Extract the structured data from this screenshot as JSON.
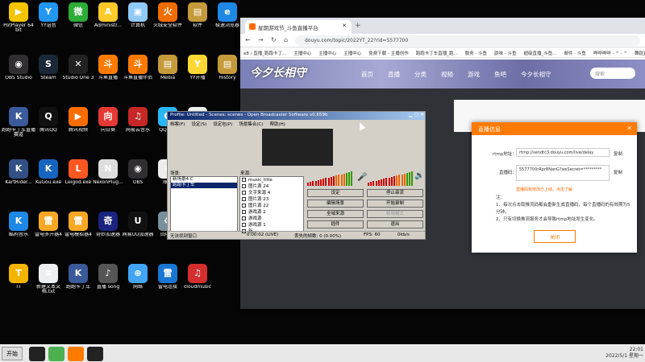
{
  "desktop_icons": [
    {
      "label": "PotPlayer 64 bit",
      "color": "#f5c400",
      "glyph": "▶"
    },
    {
      "label": "OBS Studio",
      "color": "#302e31",
      "glyph": "◉"
    },
    {
      "label": "跑跑卡丁车直播 赛道",
      "color": "#3a5a9a",
      "glyph": "K"
    },
    {
      "label": "KartRider...",
      "color": "#324f86",
      "glyph": "K"
    },
    {
      "label": "酷狗音乐",
      "color": "#1e88e5",
      "glyph": "K"
    },
    {
      "label": "TT",
      "color": "#f4b400",
      "glyph": "T"
    },
    {
      "label": "YY语音",
      "color": "#2196f3",
      "glyph": "Y"
    },
    {
      "label": "Steam",
      "color": "#1b2838",
      "glyph": "S"
    },
    {
      "label": "腾讯QQ",
      "color": "#111",
      "glyph": "Q"
    },
    {
      "label": "KuGou.exe",
      "color": "#1565c0",
      "glyph": "K"
    },
    {
      "label": "雷电多开器4",
      "color": "#f9a825",
      "glyph": "雷"
    },
    {
      "label": "新建文本文档.txt",
      "color": "#eceff1",
      "glyph": "≡"
    },
    {
      "label": "微信",
      "color": "#2bad37",
      "glyph": "微"
    },
    {
      "label": "Studio One 3",
      "color": "#222",
      "glyph": "✕"
    },
    {
      "label": "腾讯视频",
      "color": "#ff6d00",
      "glyph": "▶"
    },
    {
      "label": "Leigod.exe",
      "color": "#ff5722",
      "glyph": "L"
    },
    {
      "label": "雷电模拟器4",
      "color": "#f9a825",
      "glyph": "雷"
    },
    {
      "label": "跑跑卡丁车",
      "color": "#3a5a9a",
      "glyph": "K"
    },
    {
      "label": "Administr...",
      "color": "#ffca28",
      "glyph": "A"
    },
    {
      "label": "斗鱼直播",
      "color": "#ff7a00",
      "glyph": "斗"
    },
    {
      "label": "向日葵",
      "color": "#e53935",
      "glyph": "向"
    },
    {
      "label": "NexonPlug...",
      "color": "#ddd",
      "glyph": "N"
    },
    {
      "label": "奇妙加速器",
      "color": "#1a237e",
      "glyph": "奇"
    },
    {
      "label": "直播 song",
      "color": "#555",
      "glyph": "♪"
    },
    {
      "label": "计算机",
      "color": "#90caf9",
      "glyph": "▣"
    },
    {
      "label": "斗鱼直播伴侣",
      "color": "#ff7a00",
      "glyph": "斗"
    },
    {
      "label": "网易云音乐",
      "color": "#c62828",
      "glyph": "♫"
    },
    {
      "label": "OBS",
      "color": "#302e31",
      "glyph": "◉"
    },
    {
      "label": "网易UU加速器",
      "color": "#111",
      "glyph": "U"
    },
    {
      "label": "网络",
      "color": "#42a5f5",
      "glyph": "⊕"
    },
    {
      "label": "火绒安全软件",
      "color": "#ef6c00",
      "glyph": "火"
    },
    {
      "label": "Media",
      "color": "#c49a3a",
      "glyph": "▤"
    },
    {
      "label": "QQ游戏",
      "color": "#29b6f6",
      "glyph": "Q"
    },
    {
      "label": "账号",
      "color": "#eee",
      "glyph": "≡"
    },
    {
      "label": "回收站",
      "color": "#78909c",
      "glyph": "♻"
    },
    {
      "label": "雷电连接",
      "color": "#1976d2",
      "glyph": "雷"
    },
    {
      "label": "软件",
      "color": "#c49a3a",
      "glyph": "▤"
    },
    {
      "label": "YY开播",
      "color": "#fdd835",
      "glyph": "Y"
    },
    {
      "label": "直播效果 song",
      "color": "#eee",
      "glyph": "≡"
    },
    {
      "label": "Firefox",
      "color": "#ff7043",
      "glyph": "F"
    },
    {
      "label": "跑跑卡丁车",
      "color": "#3a5a9a",
      "glyph": "K"
    },
    {
      "label": "cloudmusic",
      "color": "#d32f2f",
      "glyph": "♫"
    },
    {
      "label": "极速浏览器",
      "color": "#1e88e5",
      "glyph": "e"
    },
    {
      "label": "History",
      "color": "#c49a3a",
      "glyph": "▤"
    }
  ],
  "taskbar": {
    "start_label": "开始",
    "time": "22:01",
    "date": "2022/5/1 星期一"
  },
  "browser": {
    "tab_title": "星期游戏节_斗鱼直播平台",
    "url": "douyu.com/topic/2022YT_22?rid=5577700",
    "bookmarks": [
      "e8 / 直播_跑跑卡丁...",
      "主播中心",
      "主播中心",
      "主播中心",
      "免费下载 - 主播创作",
      "跑跑卡丁车直播_跑...",
      "服务 · 斗鱼",
      "韵味 - 斗鱼",
      "超级直播_斗鱼...",
      "邮件 · 斗鱼",
      "哗哗哗哗 - ^ - ^",
      "舞蹈直播_斗鱼..."
    ],
    "site_logo": "今夕长相守",
    "site_nav": [
      "首页",
      "直播",
      "分类",
      "视频",
      "游戏",
      "鱼吧",
      "今夕长相守"
    ],
    "search_placeholder": "搜索"
  },
  "dialog": {
    "title": "直播信息",
    "close": "✕",
    "rtmp_label": "rtmp地址：",
    "rtmp_value": "rtmp://sendtc3.douyu.com/live/delay",
    "copy_label": "复制",
    "key_label": "直播码：",
    "key_value": "5577700rRpr8NanG?wsSecret=*********",
    "copy_label2": "复制",
    "warn": "直播码有修改已上线，点击了解",
    "notes_title": "注：",
    "note1": "1、每次点击取推流码都会重新生成直播码，每个直播码的有效期为5分钟。",
    "note2": "2、只有切换推流服务才会导致rtmp地址发生变化。",
    "close_button": "关闭"
  },
  "obs": {
    "title": "Profile: Untitled - Scenes: scenes - Open Broadcaster Software v0.659b",
    "menu": [
      "档案(F)",
      "设定(S)",
      "设定包(P)",
      "场景集合(C)",
      "帮助(H)"
    ],
    "scene_label": "场景:",
    "source_label": "来源:",
    "scenes": [
      "新场景4 C",
      "跑跑卡丁车"
    ],
    "sources": [
      "music_title",
      "图片源 24",
      "文字来源 4",
      "图片源 23",
      "图片源 22",
      "游戏源 2",
      "游戏源",
      "游戏源 1",
      "新..."
    ],
    "buttons": {
      "settings": "设定",
      "stop_stream": "停止串流",
      "edit_scene": "编辑场景",
      "start_record": "开始录制",
      "fullscreen": "全域来源",
      "plugins": "插件",
      "exit": "退出",
      "mini": "精简模式"
    },
    "status_left": "无法找到窗口",
    "status_time": "0:00:02 (LIVE)",
    "status_drop": "丢失的帧数: 0 (0.00%)",
    "status_fps": "FPS: 60",
    "status_kbps": "0kb/s"
  }
}
